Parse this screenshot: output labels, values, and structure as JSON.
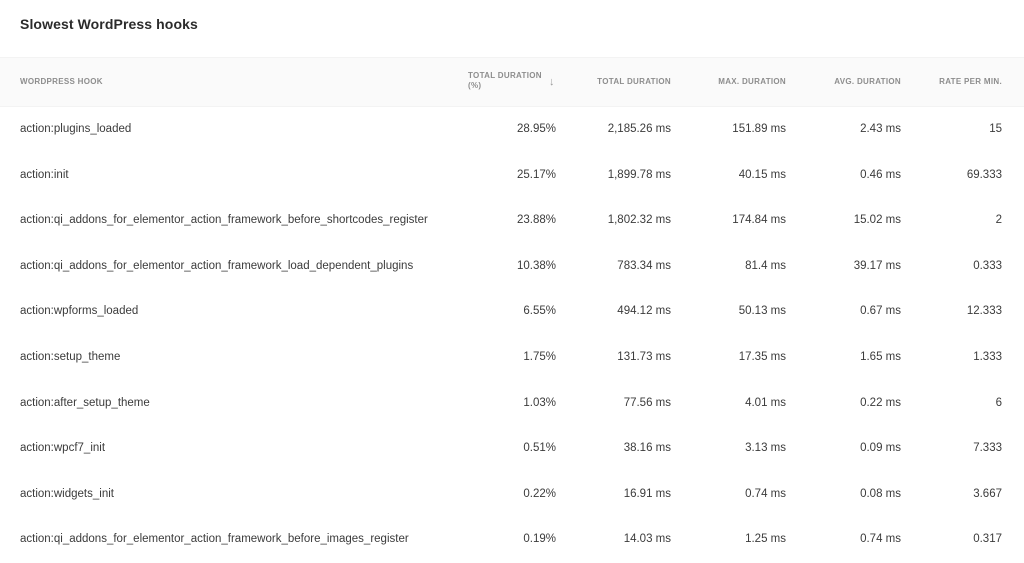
{
  "title": "Slowest WordPress hooks",
  "columns": {
    "hook": "WORDPRESS HOOK",
    "total_pct": "TOTAL DURATION (%)",
    "sort_icon": "↓",
    "total": "TOTAL DURATION",
    "max": "MAX. DURATION",
    "avg": "AVG. DURATION",
    "rate": "RATE PER MIN."
  },
  "rows": [
    {
      "hook": "action:plugins_loaded",
      "pct": "28.95%",
      "total": "2,185.26 ms",
      "max": "151.89 ms",
      "avg": "2.43 ms",
      "rate": "15"
    },
    {
      "hook": "action:init",
      "pct": "25.17%",
      "total": "1,899.78 ms",
      "max": "40.15 ms",
      "avg": "0.46 ms",
      "rate": "69.333"
    },
    {
      "hook": "action:qi_addons_for_elementor_action_framework_before_shortcodes_register",
      "pct": "23.88%",
      "total": "1,802.32 ms",
      "max": "174.84 ms",
      "avg": "15.02 ms",
      "rate": "2"
    },
    {
      "hook": "action:qi_addons_for_elementor_action_framework_load_dependent_plugins",
      "pct": "10.38%",
      "total": "783.34 ms",
      "max": "81.4 ms",
      "avg": "39.17 ms",
      "rate": "0.333"
    },
    {
      "hook": "action:wpforms_loaded",
      "pct": "6.55%",
      "total": "494.12 ms",
      "max": "50.13 ms",
      "avg": "0.67 ms",
      "rate": "12.333"
    },
    {
      "hook": "action:setup_theme",
      "pct": "1.75%",
      "total": "131.73 ms",
      "max": "17.35 ms",
      "avg": "1.65 ms",
      "rate": "1.333"
    },
    {
      "hook": "action:after_setup_theme",
      "pct": "1.03%",
      "total": "77.56 ms",
      "max": "4.01 ms",
      "avg": "0.22 ms",
      "rate": "6"
    },
    {
      "hook": "action:wpcf7_init",
      "pct": "0.51%",
      "total": "38.16 ms",
      "max": "3.13 ms",
      "avg": "0.09 ms",
      "rate": "7.333"
    },
    {
      "hook": "action:widgets_init",
      "pct": "0.22%",
      "total": "16.91 ms",
      "max": "0.74 ms",
      "avg": "0.08 ms",
      "rate": "3.667"
    },
    {
      "hook": "action:qi_addons_for_elementor_action_framework_before_images_register",
      "pct": "0.19%",
      "total": "14.03 ms",
      "max": "1.25 ms",
      "avg": "0.74 ms",
      "rate": "0.317"
    }
  ]
}
